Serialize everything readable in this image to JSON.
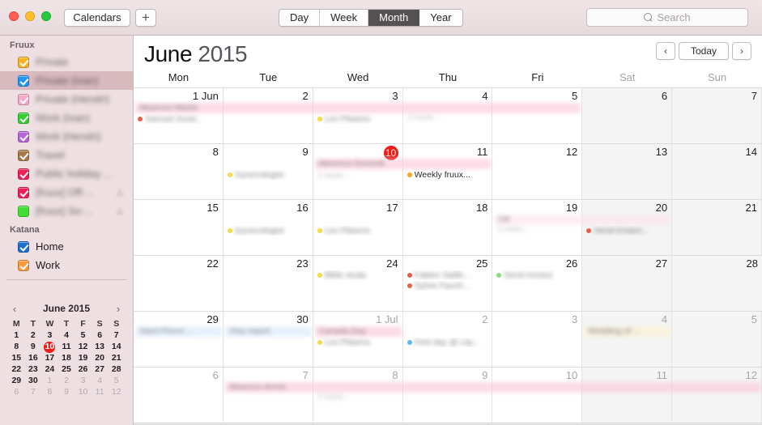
{
  "window": {
    "traffic_lights": [
      "close",
      "minimize",
      "zoom"
    ]
  },
  "toolbar": {
    "calendars_label": "Calendars",
    "add_label": "+",
    "views": [
      {
        "label": "Day",
        "active": false
      },
      {
        "label": "Week",
        "active": false
      },
      {
        "label": "Month",
        "active": true
      },
      {
        "label": "Year",
        "active": false
      }
    ],
    "search_placeholder": "Search",
    "search_value": ""
  },
  "sidebar": {
    "groups": [
      {
        "title": "Fruux",
        "items": [
          {
            "label": "Private",
            "color": "#f5b324",
            "checked": true,
            "selected": false,
            "blurred": true,
            "shared": false
          },
          {
            "label": "Private (Ivan)",
            "color": "#2196f3",
            "checked": true,
            "selected": true,
            "blurred": true,
            "shared": false
          },
          {
            "label": "Private (Hendri)",
            "color": "#f4a9c8",
            "checked": true,
            "selected": false,
            "blurred": true,
            "shared": false
          },
          {
            "label": "Work (Ivan)",
            "color": "#33cc33",
            "checked": true,
            "selected": false,
            "blurred": true,
            "shared": false
          },
          {
            "label": "Work (Hendri)",
            "color": "#b565d8",
            "checked": true,
            "selected": false,
            "blurred": true,
            "shared": false
          },
          {
            "label": "Travel",
            "color": "#a47a4c",
            "checked": true,
            "selected": false,
            "blurred": true,
            "shared": false
          },
          {
            "label": "Public holiday ...",
            "color": "#ef1f55",
            "checked": true,
            "selected": false,
            "blurred": true,
            "shared": false
          },
          {
            "label": "[fruux] Off-...",
            "color": "#ef1f55",
            "checked": true,
            "selected": false,
            "blurred": true,
            "shared": true
          },
          {
            "label": "[fruux] So-...",
            "color": "#44dd33",
            "checked": false,
            "selected": false,
            "blurred": true,
            "shared": true
          }
        ]
      },
      {
        "title": "Katana",
        "items": [
          {
            "label": "Home",
            "color": "#1f6fd0",
            "checked": true,
            "selected": false,
            "blurred": false,
            "shared": false
          },
          {
            "label": "Work",
            "color": "#f49b3c",
            "checked": true,
            "selected": false,
            "blurred": false,
            "shared": false
          }
        ]
      }
    ]
  },
  "mini_calendar": {
    "title": "June 2015",
    "prev_label": "‹",
    "next_label": "›",
    "dow": [
      "M",
      "T",
      "W",
      "T",
      "F",
      "S",
      "S"
    ],
    "weeks": [
      [
        {
          "d": "1"
        },
        {
          "d": "2"
        },
        {
          "d": "3"
        },
        {
          "d": "4"
        },
        {
          "d": "5"
        },
        {
          "d": "6"
        },
        {
          "d": "7"
        }
      ],
      [
        {
          "d": "8"
        },
        {
          "d": "9"
        },
        {
          "d": "10",
          "today": true
        },
        {
          "d": "11"
        },
        {
          "d": "12"
        },
        {
          "d": "13"
        },
        {
          "d": "14"
        }
      ],
      [
        {
          "d": "15"
        },
        {
          "d": "16"
        },
        {
          "d": "17"
        },
        {
          "d": "18"
        },
        {
          "d": "19"
        },
        {
          "d": "20"
        },
        {
          "d": "21"
        }
      ],
      [
        {
          "d": "22"
        },
        {
          "d": "23"
        },
        {
          "d": "24"
        },
        {
          "d": "25"
        },
        {
          "d": "26"
        },
        {
          "d": "27"
        },
        {
          "d": "28"
        }
      ],
      [
        {
          "d": "29"
        },
        {
          "d": "30"
        },
        {
          "d": "1",
          "muted": true
        },
        {
          "d": "2",
          "muted": true
        },
        {
          "d": "3",
          "muted": true
        },
        {
          "d": "4",
          "muted": true
        },
        {
          "d": "5",
          "muted": true
        }
      ],
      [
        {
          "d": "6",
          "muted": true
        },
        {
          "d": "7",
          "muted": true
        },
        {
          "d": "8",
          "muted": true
        },
        {
          "d": "9",
          "muted": true
        },
        {
          "d": "10",
          "muted": true
        },
        {
          "d": "11",
          "muted": true
        },
        {
          "d": "12",
          "muted": true
        }
      ]
    ]
  },
  "main": {
    "month_name": "June",
    "year": "2015",
    "nav": {
      "prev": "‹",
      "today": "Today",
      "next": "›"
    },
    "dow": [
      {
        "label": "Mon",
        "weekend": false
      },
      {
        "label": "Tue",
        "weekend": false
      },
      {
        "label": "Wed",
        "weekend": false
      },
      {
        "label": "Thu",
        "weekend": false
      },
      {
        "label": "Fri",
        "weekend": false
      },
      {
        "label": "Sat",
        "weekend": true
      },
      {
        "label": "Sun",
        "weekend": true
      }
    ],
    "weeks": [
      {
        "days": [
          {
            "num": "1 Jun",
            "muted": false,
            "weekend": false,
            "events": [
              {
                "text": "Samuel Zund...",
                "color": "#e8604c",
                "blurred": true
              }
            ]
          },
          {
            "num": "2",
            "muted": false,
            "weekend": false,
            "events": []
          },
          {
            "num": "3",
            "muted": false,
            "weekend": false,
            "events": [
              {
                "text": "Les Pilasms",
                "color": "#f5d94b",
                "blurred": true
              }
            ]
          },
          {
            "num": "4",
            "muted": false,
            "weekend": false,
            "events": [],
            "more": "2 more..."
          },
          {
            "num": "5",
            "muted": false,
            "weekend": false,
            "events": []
          },
          {
            "num": "6",
            "muted": false,
            "weekend": true,
            "events": []
          },
          {
            "num": "7",
            "muted": false,
            "weekend": true,
            "events": []
          }
        ],
        "bands": [
          {
            "text": "Absence Martin",
            "style": "pink",
            "start": 0,
            "span": 5,
            "row": 0,
            "blurred": true
          }
        ]
      },
      {
        "days": [
          {
            "num": "8",
            "muted": false,
            "weekend": false,
            "events": []
          },
          {
            "num": "9",
            "muted": false,
            "weekend": false,
            "events": [
              {
                "text": "Gynecologist",
                "color": "#f5d94b",
                "blurred": true
              }
            ]
          },
          {
            "num": "10",
            "muted": false,
            "weekend": false,
            "today": true,
            "events": [],
            "more": "2 more..."
          },
          {
            "num": "11",
            "muted": false,
            "weekend": false,
            "events": [
              {
                "text": "Weekly fruux...",
                "color": "#f5a623",
                "blurred": false
              }
            ]
          },
          {
            "num": "12",
            "muted": false,
            "weekend": false,
            "events": []
          },
          {
            "num": "13",
            "muted": false,
            "weekend": true,
            "events": []
          },
          {
            "num": "14",
            "muted": false,
            "weekend": true,
            "events": []
          }
        ],
        "bands": [
          {
            "text": "Absence Dominik",
            "style": "pink",
            "start": 2,
            "span": 2,
            "row": 0,
            "blurred": true
          }
        ]
      },
      {
        "days": [
          {
            "num": "15",
            "muted": false,
            "weekend": false,
            "events": []
          },
          {
            "num": "16",
            "muted": false,
            "weekend": false,
            "events": [
              {
                "text": "Gynecologist",
                "color": "#f5d94b",
                "blurred": true
              }
            ]
          },
          {
            "num": "17",
            "muted": false,
            "weekend": false,
            "events": [
              {
                "text": "Les Pilasms",
                "color": "#f5d94b",
                "blurred": true
              }
            ]
          },
          {
            "num": "18",
            "muted": false,
            "weekend": false,
            "events": []
          },
          {
            "num": "19",
            "muted": false,
            "weekend": false,
            "events": [],
            "more": "2 more..."
          },
          {
            "num": "20",
            "muted": false,
            "weekend": true,
            "events": [
              {
                "text": "Hend Endert...",
                "color": "#e8604c",
                "blurred": true
              }
            ]
          },
          {
            "num": "21",
            "muted": false,
            "weekend": true,
            "events": []
          }
        ],
        "bands": [
          {
            "text": "Ott",
            "style": "pinklight",
            "start": 4,
            "span": 2,
            "row": 0,
            "blurred": true
          }
        ]
      },
      {
        "days": [
          {
            "num": "22",
            "muted": false,
            "weekend": false,
            "events": []
          },
          {
            "num": "23",
            "muted": false,
            "weekend": false,
            "events": []
          },
          {
            "num": "24",
            "muted": false,
            "weekend": false,
            "events": [
              {
                "text": "Bible study",
                "color": "#f5d94b",
                "blurred": true
              }
            ]
          },
          {
            "num": "25",
            "muted": false,
            "weekend": false,
            "events": [
              {
                "text": "Fabien Saille...",
                "color": "#e8604c",
                "blurred": true
              },
              {
                "text": "Sylvie Fauch...",
                "color": "#e8604c",
                "blurred": true
              }
            ]
          },
          {
            "num": "26",
            "muted": false,
            "weekend": false,
            "events": [
              {
                "text": "Send invoice",
                "color": "#8ddc7a",
                "blurred": true
              }
            ]
          },
          {
            "num": "27",
            "muted": false,
            "weekend": true,
            "events": []
          },
          {
            "num": "28",
            "muted": false,
            "weekend": true,
            "events": []
          }
        ],
        "bands": []
      },
      {
        "days": [
          {
            "num": "29",
            "muted": false,
            "weekend": false,
            "events": []
          },
          {
            "num": "30",
            "muted": false,
            "weekend": false,
            "events": []
          },
          {
            "num": "1 Jul",
            "muted": true,
            "weekend": false,
            "events": [
              {
                "text": "Les Pilasms",
                "color": "#f5d94b",
                "blurred": true
              }
            ]
          },
          {
            "num": "2",
            "muted": true,
            "weekend": false,
            "events": [
              {
                "text": "First day @ Lily...",
                "color": "#5bb9ef",
                "blurred": true
              }
            ]
          },
          {
            "num": "3",
            "muted": true,
            "weekend": false,
            "events": []
          },
          {
            "num": "4",
            "muted": true,
            "weekend": true,
            "events": []
          },
          {
            "num": "5",
            "muted": true,
            "weekend": true,
            "events": []
          }
        ],
        "bands": [
          {
            "text": "Saint-Pierre ...",
            "style": "blue",
            "start": 0,
            "span": 1,
            "row": 0,
            "blurred": true
          },
          {
            "text": "Visa report",
            "style": "blue",
            "start": 1,
            "span": 1,
            "row": 0,
            "blurred": true
          },
          {
            "text": "Canada Day",
            "style": "pink",
            "start": 2,
            "span": 1,
            "row": 0,
            "blurred": true
          },
          {
            "text": "Wedding of ...",
            "style": "cream",
            "start": 5,
            "span": 1,
            "row": 0,
            "blurred": true
          }
        ]
      },
      {
        "days": [
          {
            "num": "6",
            "muted": true,
            "weekend": false,
            "events": []
          },
          {
            "num": "7",
            "muted": true,
            "weekend": false,
            "events": []
          },
          {
            "num": "8",
            "muted": true,
            "weekend": false,
            "events": [],
            "more": "2 more..."
          },
          {
            "num": "9",
            "muted": true,
            "weekend": false,
            "events": []
          },
          {
            "num": "10",
            "muted": true,
            "weekend": false,
            "events": []
          },
          {
            "num": "11",
            "muted": true,
            "weekend": true,
            "events": []
          },
          {
            "num": "12",
            "muted": true,
            "weekend": true,
            "events": []
          }
        ],
        "bands": [
          {
            "text": "Absence Armin",
            "style": "pink",
            "start": 1,
            "span": 6,
            "row": 0,
            "blurred": true
          }
        ]
      }
    ]
  }
}
